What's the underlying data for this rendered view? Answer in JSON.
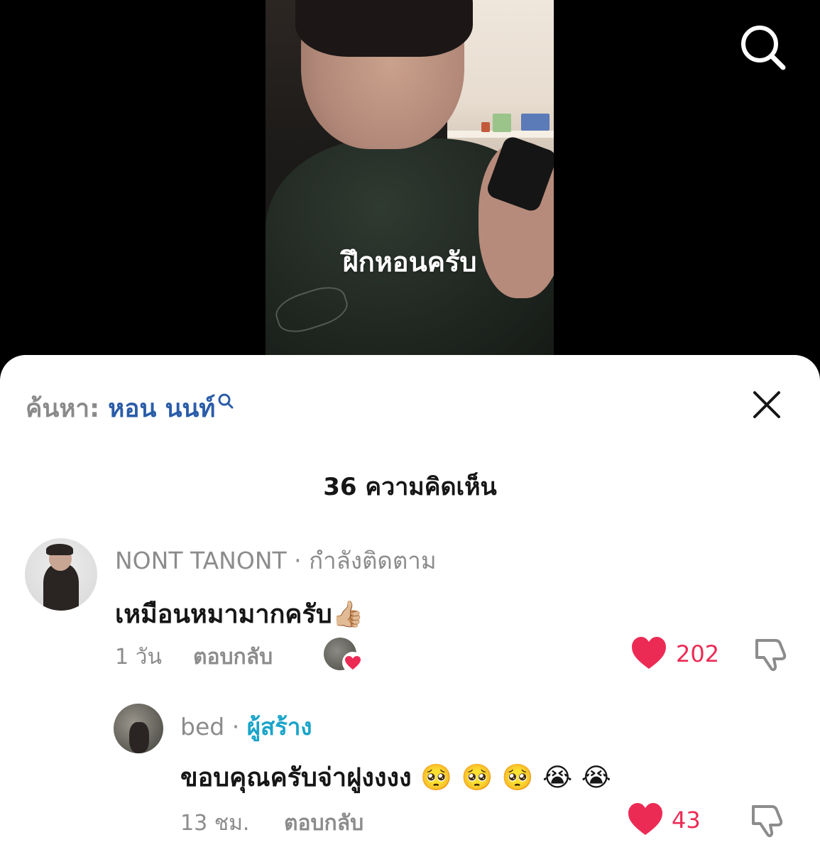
{
  "video": {
    "caption": "ฝึกหอนครับ",
    "top_search_icon": "search-icon"
  },
  "sheet": {
    "search_prefix": "ค้นหา: ",
    "search_term": "หอน นนท์",
    "close_icon": "close-icon",
    "comment_count": "36 ความคิดเห็น"
  },
  "comments": [
    {
      "username": "NONT TANONT",
      "badge": "· กำลังติดตาม",
      "text": "เหมือนหมามากครับ👍🏼",
      "time": "1 วัน",
      "reply_label": "ตอบกลับ",
      "likes": "202",
      "creator_liked": true
    },
    {
      "username": "bed",
      "badge_sep": " · ",
      "badge": "ผู้สร้าง",
      "text": "ขอบคุณครับจ่าฝูงงงง 🥺 🥺 🥺 😭 😭",
      "time": "13 ชม.",
      "reply_label": "ตอบกลับ",
      "likes": "43"
    }
  ],
  "colors": {
    "accent_blue": "#2a5ca8",
    "creator_cyan": "#19a4c9",
    "like_red": "#ec2b55",
    "muted_gray": "#8c8c8c"
  }
}
